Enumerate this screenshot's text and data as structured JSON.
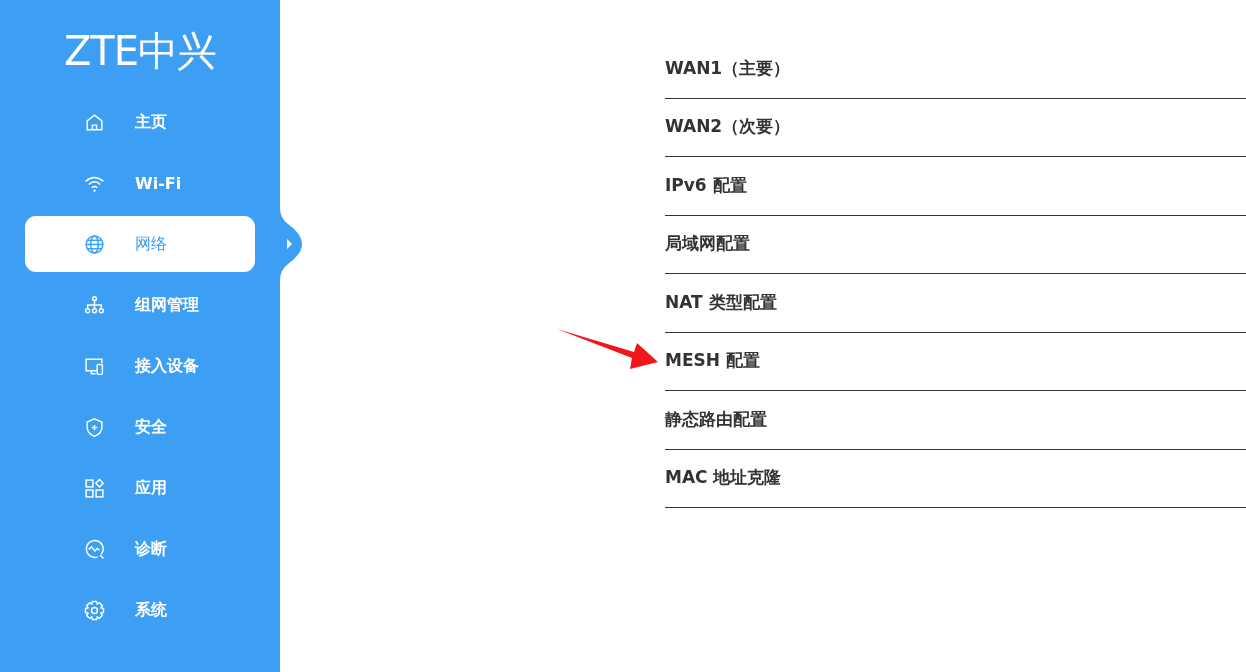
{
  "sidebar": {
    "logo": "ZTE中兴",
    "items": [
      {
        "label": "主页",
        "selected": false
      },
      {
        "label": "Wi-Fi",
        "selected": false
      },
      {
        "label": "网络",
        "selected": true
      },
      {
        "label": "组网管理",
        "selected": false
      },
      {
        "label": "接入设备",
        "selected": false
      },
      {
        "label": "安全",
        "selected": false
      },
      {
        "label": "应用",
        "selected": false
      },
      {
        "label": "诊断",
        "selected": false
      },
      {
        "label": "系统",
        "selected": false
      }
    ]
  },
  "menu": {
    "items": [
      {
        "label": "WAN1（主要）",
        "marked": false
      },
      {
        "label": "WAN2（次要）",
        "marked": false
      },
      {
        "label": "IPv6 配置",
        "marked": false
      },
      {
        "label": "局域网配置",
        "marked": false
      },
      {
        "label": "NAT 类型配置",
        "marked": false
      },
      {
        "label": "MESH 配置",
        "marked": true
      },
      {
        "label": "静态路由配置",
        "marked": false
      },
      {
        "label": "MAC 地址克隆",
        "marked": false
      }
    ]
  }
}
